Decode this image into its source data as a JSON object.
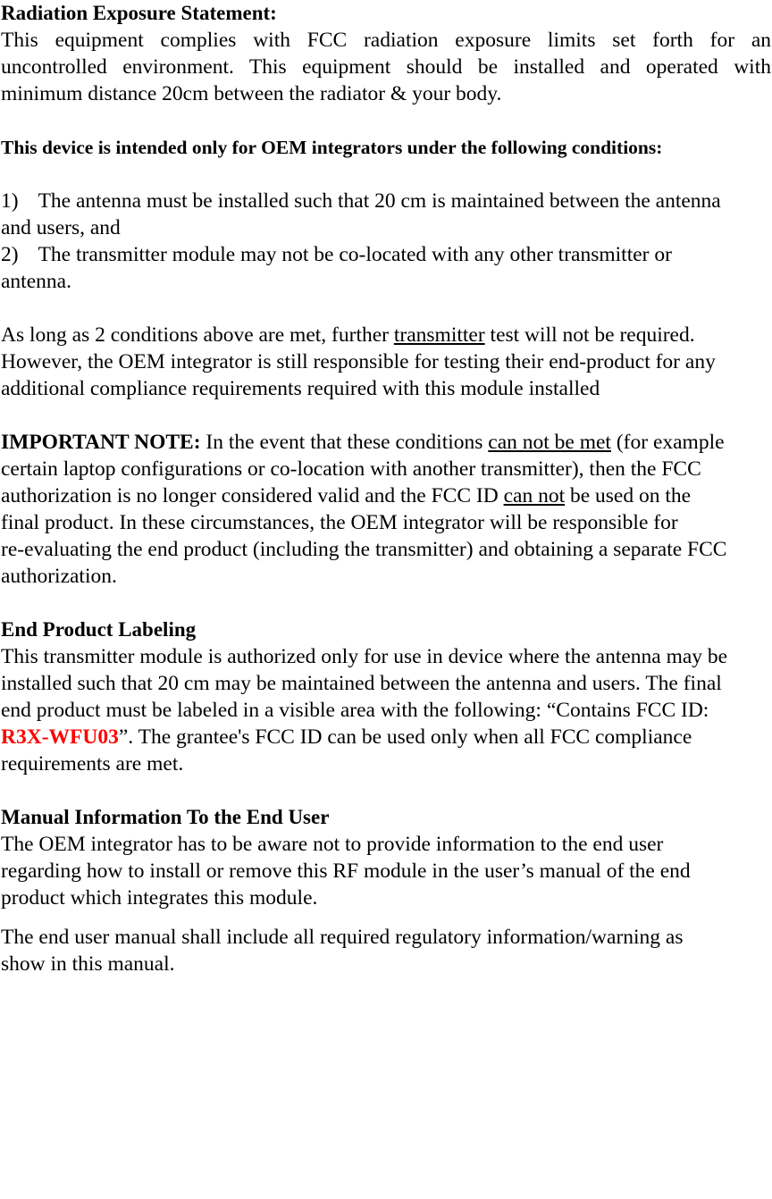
{
  "document": {
    "type": "fcc-oem-integrator-compliance-statement",
    "accent_color": "#FF0000",
    "text_color": "#000000",
    "background_color": "#FFFFFF"
  },
  "sections": {
    "radiation_exposure": {
      "heading": "Radiation Exposure Statement:",
      "body_lines": [
        "This equipment complies with FCC radiation exposure limits set forth for an",
        "uncontrolled environment. This equipment should be installed and operated with",
        "minimum distance 20cm between the radiator & your body."
      ]
    },
    "oem_conditions": {
      "heading": "This device is intended only for OEM integrators under the following conditions:",
      "items": [
        {
          "marker": "1)",
          "lines": [
            "The antenna must be installed such that 20 cm is maintained between the antenna",
            "and users, and"
          ]
        },
        {
          "marker": "2)",
          "lines": [
            "The transmitter module may not be co-located with any other transmitter or",
            "antenna."
          ]
        }
      ]
    },
    "conditions_met": {
      "line1_a": "As long as 2 conditions above are met, further ",
      "line1_underlined": "transmitter",
      "line1_b": " test will not be required.",
      "line2": "However, the OEM integrator is still responsible for testing their end-product for any",
      "line3": "additional compliance requirements required with this module installed"
    },
    "important_note": {
      "label": "IMPORTANT NOTE:",
      "line1_a": " In the event that these conditions ",
      "line1_underlined": "can not be met",
      "line1_b": " (for example",
      "line2": "certain laptop configurations or co-location with another transmitter), then the FCC",
      "line3_a": "authorization is no longer considered valid and the FCC ID ",
      "line3_underlined": "can not",
      "line3_b": " be used on the",
      "line4": "final product. In these circumstances, the OEM integrator will be responsible for",
      "line5": "re-evaluating the end product (including the transmitter) and obtaining a separate FCC",
      "line6": "authorization."
    },
    "end_product_labeling": {
      "heading": "End Product Labeling",
      "line1": "This transmitter module is authorized only for use in device where the antenna may be",
      "line2": "installed such that 20 cm may be maintained between the antenna and users. The final",
      "line3": "end product must be labeled in a visible area with the following: “Contains FCC ID:",
      "line4_fcc_id": "R3X-WFU03",
      "line4_after": "”. The grantee's FCC ID can be used only when all FCC compliance",
      "line5": "requirements are met."
    },
    "manual_information": {
      "heading": "Manual Information To the End User",
      "para1_lines": [
        "The OEM integrator has to be aware not to provide information to the end user",
        "regarding how to install or remove this RF module in the user’s manual of the end",
        "product which integrates this module."
      ],
      "para2_lines": [
        "The end user manual shall include all required regulatory information/warning as",
        "show in this manual."
      ]
    }
  }
}
